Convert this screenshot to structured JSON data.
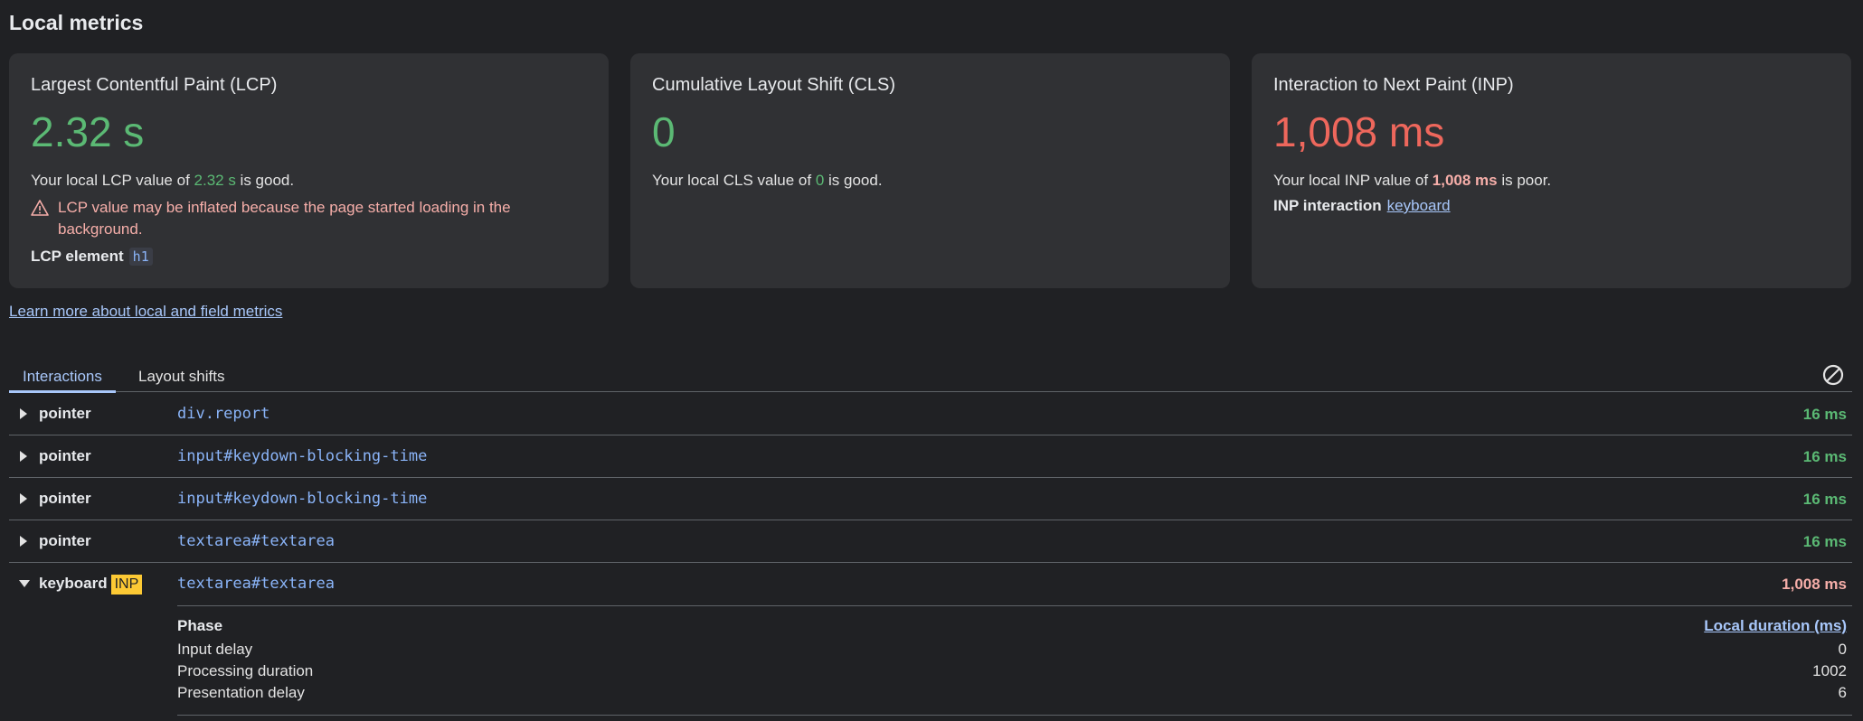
{
  "section_title": "Local metrics",
  "cards": {
    "lcp": {
      "title": "Largest Contentful Paint (LCP)",
      "value": "2.32 s",
      "desc_prefix": "Your local LCP value of ",
      "desc_value": "2.32 s",
      "desc_suffix": " is good.",
      "warning": "LCP value may be inflated because the page started loading in the background.",
      "element_label": "LCP element",
      "element_value": "h1"
    },
    "cls": {
      "title": "Cumulative Layout Shift (CLS)",
      "value": "0",
      "desc_prefix": "Your local CLS value of ",
      "desc_value": "0",
      "desc_suffix": " is good."
    },
    "inp": {
      "title": "Interaction to Next Paint (INP)",
      "value": "1,008 ms",
      "desc_prefix": "Your local INP value of ",
      "desc_value": "1,008 ms",
      "desc_suffix": " is poor.",
      "interaction_label": "INP interaction",
      "interaction_link": "keyboard"
    }
  },
  "learn_more": "Learn more about local and field metrics",
  "tabs": [
    "Interactions",
    "Layout shifts"
  ],
  "interactions": [
    {
      "type": "pointer",
      "selector": "div.report",
      "duration": "16 ms"
    },
    {
      "type": "pointer",
      "selector": "input#keydown-blocking-time",
      "duration": "16 ms"
    },
    {
      "type": "pointer",
      "selector": "input#keydown-blocking-time",
      "duration": "16 ms"
    },
    {
      "type": "pointer",
      "selector": "textarea#textarea",
      "duration": "16 ms"
    },
    {
      "type": "keyboard",
      "badge": "INP",
      "selector": "textarea#textarea",
      "duration": "1,008 ms"
    }
  ],
  "phases": {
    "header_name": "Phase",
    "header_duration": "Local duration (ms)",
    "rows": [
      {
        "name": "Input delay",
        "value": "0"
      },
      {
        "name": "Processing duration",
        "value": "1002"
      },
      {
        "name": "Presentation delay",
        "value": "6"
      }
    ]
  },
  "colors": {
    "good": "#5bb974",
    "poor": "#ee675c",
    "accent": "#a8c7fa",
    "badge": "#fcc934"
  }
}
